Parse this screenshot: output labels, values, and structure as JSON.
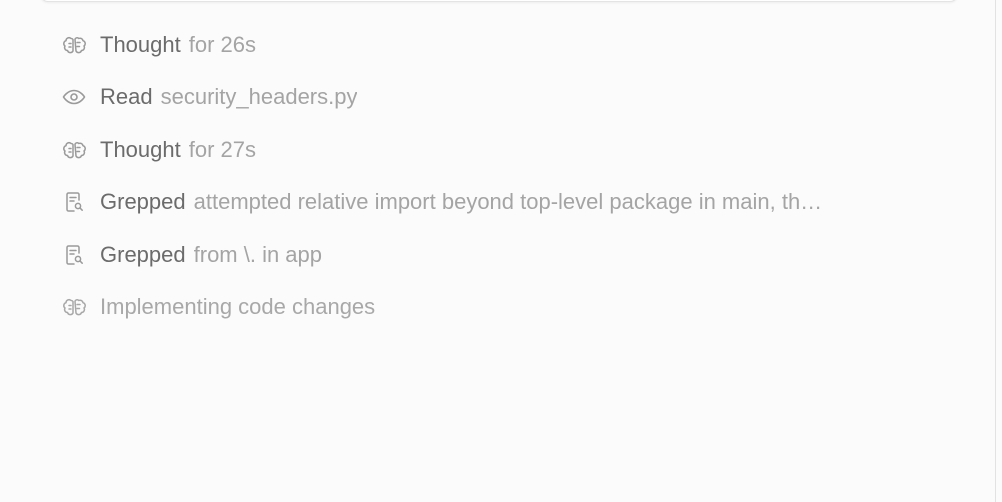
{
  "activity": {
    "steps": [
      {
        "icon": "brain-icon",
        "verb": "Thought",
        "detail": "for 26s"
      },
      {
        "icon": "eye-icon",
        "verb": "Read",
        "detail": "security_headers.py"
      },
      {
        "icon": "brain-icon",
        "verb": "Thought",
        "detail": "for 27s"
      },
      {
        "icon": "file-search-icon",
        "verb": "Grepped",
        "detail": "attempted relative import beyond top-level package in main, th…"
      },
      {
        "icon": "file-search-icon",
        "verb": "Grepped",
        "detail": "from \\. in app"
      },
      {
        "icon": "brain-icon",
        "verb": "",
        "detail": "Implementing code changes"
      }
    ]
  },
  "colors": {
    "background": "#fbfbfb",
    "verb": "#6b6b6b",
    "detail": "#a4a4a4",
    "icon": "#9a9a9a"
  }
}
